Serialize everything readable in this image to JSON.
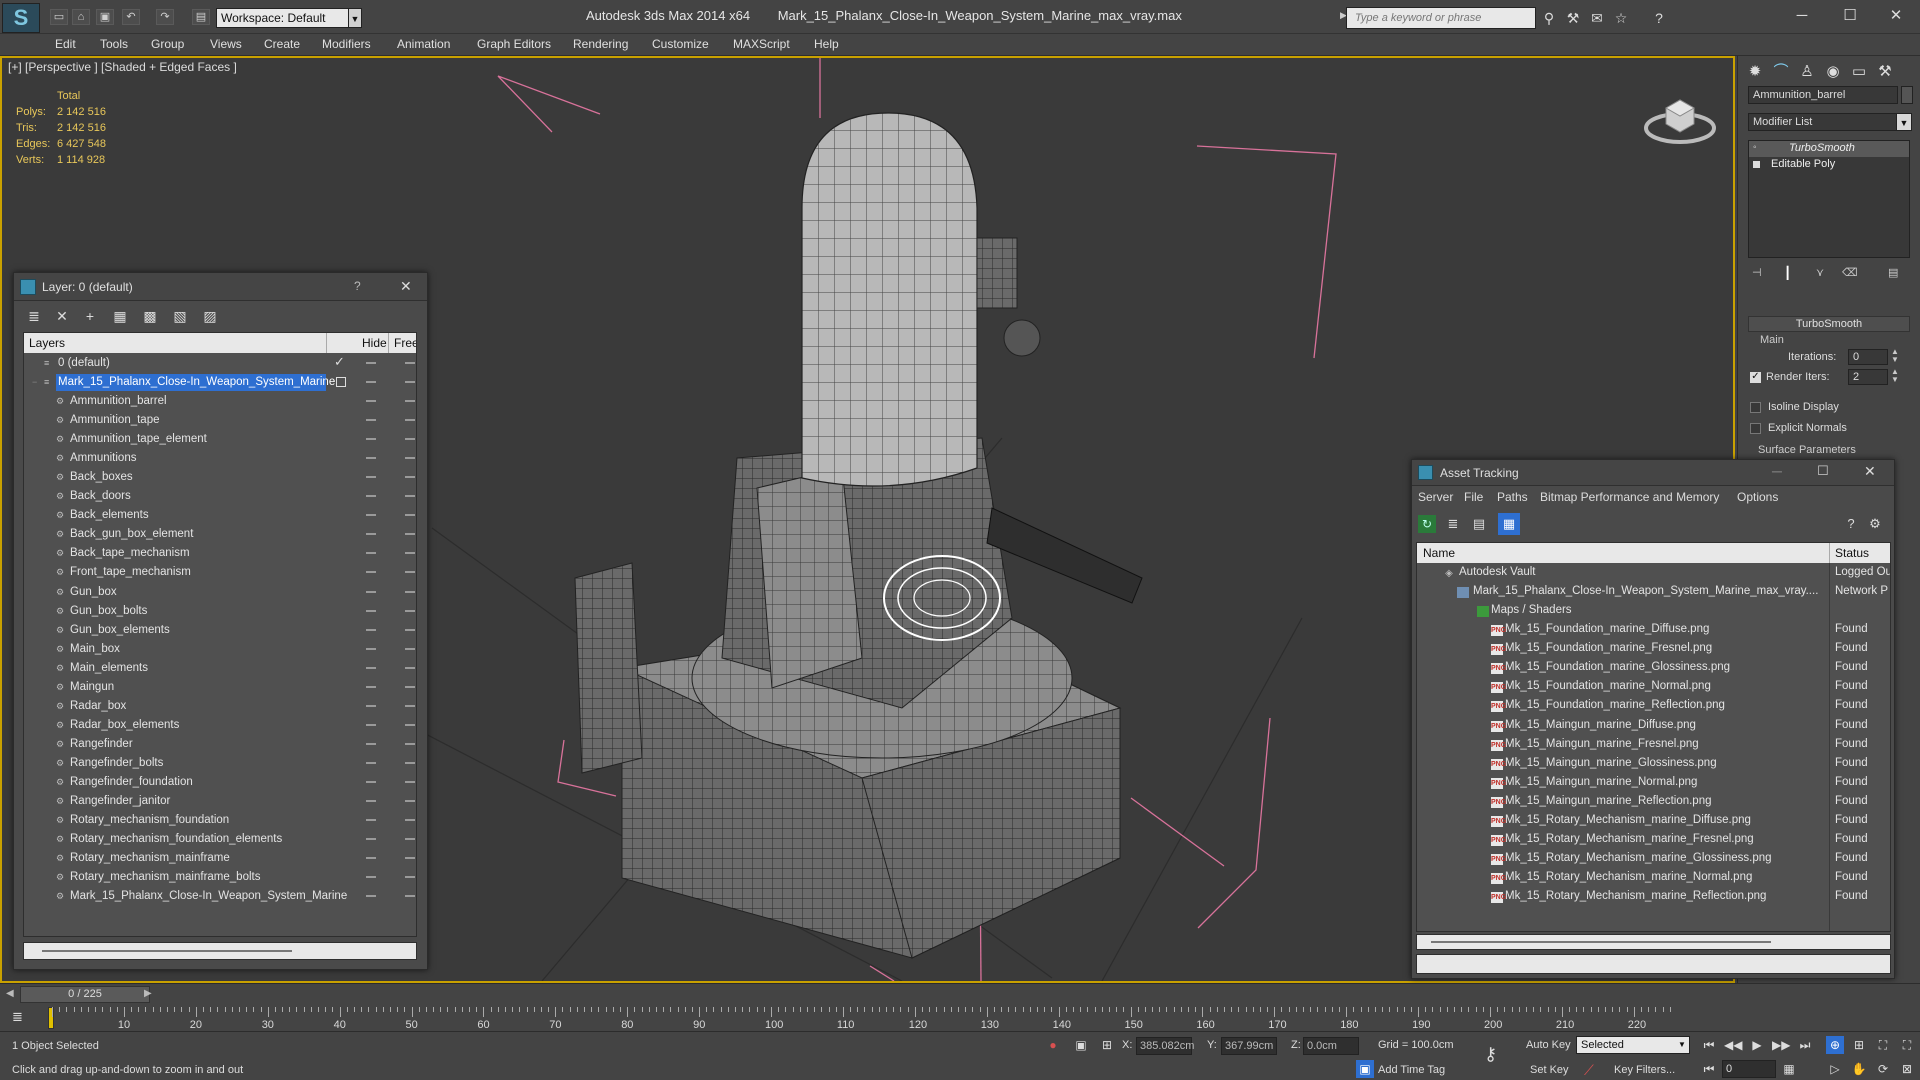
{
  "window": {
    "app_title": "Autodesk 3ds Max  2014 x64",
    "file_title": "Mark_15_Phalanx_Close-In_Weapon_System_Marine_max_vray.max",
    "workspace": "Workspace: Default",
    "search_placeholder": "Type a keyword or phrase"
  },
  "menu": [
    "Edit",
    "Tools",
    "Group",
    "Views",
    "Create",
    "Modifiers",
    "Animation",
    "Graph Editors",
    "Rendering",
    "Customize",
    "MAXScript",
    "Help"
  ],
  "viewport": {
    "label": "[+] [Perspective ] [Shaded + Edged Faces ]",
    "stats": {
      "header": "Total",
      "rows": [
        {
          "label": "Polys:",
          "value": "2 142 516"
        },
        {
          "label": "Tris:",
          "value": "2 142 516"
        },
        {
          "label": "Edges:",
          "value": "6 427 548"
        },
        {
          "label": "Verts:",
          "value": "1 114 928"
        }
      ]
    }
  },
  "layer_panel": {
    "title": "Layer: 0 (default)",
    "help": "?",
    "close": "✕",
    "columns": {
      "name": "Layers",
      "hide": "Hide",
      "freeze": "Free"
    },
    "default_layer": "0 (default)",
    "selected_layer": "Mark_15_Phalanx_Close-In_Weapon_System_Marine",
    "objects": [
      "Ammunition_barrel",
      "Ammunition_tape",
      "Ammunition_tape_element",
      "Ammunitions",
      "Back_boxes",
      "Back_doors",
      "Back_elements",
      "Back_gun_box_element",
      "Back_tape_mechanism",
      "Front_tape_mechanism",
      "Gun_box",
      "Gun_box_bolts",
      "Gun_box_elements",
      "Main_box",
      "Main_elements",
      "Maingun",
      "Radar_box",
      "Radar_box_elements",
      "Rangefinder",
      "Rangefinder_bolts",
      "Rangefinder_foundation",
      "Rangefinder_janitor",
      "Rotary_mechanism_foundation",
      "Rotary_mechanism_foundation_elements",
      "Rotary_mechanism_mainframe",
      "Rotary_mechanism_mainframe_bolts",
      "Mark_15_Phalanx_Close-In_Weapon_System_Marine"
    ]
  },
  "command_panel": {
    "object_name": "Ammunition_barrel",
    "modifier_list": "Modifier List",
    "stack": [
      "TurboSmooth",
      "Editable Poly"
    ],
    "rollout_title": "TurboSmooth",
    "main_label": "Main",
    "iterations_label": "Iterations:",
    "iterations_value": "0",
    "render_iters_label": "Render Iters:",
    "render_iters_value": "2",
    "render_iters_checked": true,
    "isoline_label": "Isoline Display",
    "explicit_normals_label": "Explicit Normals",
    "surface_params": "Surface Parameters"
  },
  "asset_tracking": {
    "title": "Asset Tracking",
    "menu": [
      "Server",
      "File",
      "Paths",
      "Bitmap Performance and Memory",
      "Options"
    ],
    "columns": {
      "name": "Name",
      "status": "Status"
    },
    "vault": {
      "name": "Autodesk Vault",
      "status": "Logged Ou"
    },
    "file": {
      "name": "Mark_15_Phalanx_Close-In_Weapon_System_Marine_max_vray....",
      "status": "Network P"
    },
    "group": "Maps / Shaders",
    "maps": [
      {
        "name": "Mk_15_Foundation_marine_Diffuse.png",
        "status": "Found"
      },
      {
        "name": "Mk_15_Foundation_marine_Fresnel.png",
        "status": "Found"
      },
      {
        "name": "Mk_15_Foundation_marine_Glossiness.png",
        "status": "Found"
      },
      {
        "name": "Mk_15_Foundation_marine_Normal.png",
        "status": "Found"
      },
      {
        "name": "Mk_15_Foundation_marine_Reflection.png",
        "status": "Found"
      },
      {
        "name": "Mk_15_Maingun_marine_Diffuse.png",
        "status": "Found"
      },
      {
        "name": "Mk_15_Maingun_marine_Fresnel.png",
        "status": "Found"
      },
      {
        "name": "Mk_15_Maingun_marine_Glossiness.png",
        "status": "Found"
      },
      {
        "name": "Mk_15_Maingun_marine_Normal.png",
        "status": "Found"
      },
      {
        "name": "Mk_15_Maingun_marine_Reflection.png",
        "status": "Found"
      },
      {
        "name": "Mk_15_Rotary_Mechanism_marine_Diffuse.png",
        "status": "Found"
      },
      {
        "name": "Mk_15_Rotary_Mechanism_marine_Fresnel.png",
        "status": "Found"
      },
      {
        "name": "Mk_15_Rotary_Mechanism_marine_Glossiness.png",
        "status": "Found"
      },
      {
        "name": "Mk_15_Rotary_Mechanism_marine_Normal.png",
        "status": "Found"
      },
      {
        "name": "Mk_15_Rotary_Mechanism_marine_Reflection.png",
        "status": "Found"
      }
    ]
  },
  "timeline": {
    "frame_counter": "0 / 225",
    "ticks": [
      "10",
      "20",
      "30",
      "40",
      "50",
      "60",
      "70",
      "80",
      "90",
      "100",
      "110",
      "120",
      "130",
      "140",
      "150",
      "160",
      "170",
      "180",
      "190",
      "200",
      "210",
      "220"
    ]
  },
  "status_bar": {
    "selection": "1 Object Selected",
    "prompt": "Click and drag up-and-down to zoom in and out",
    "x_label": "X:",
    "x_value": "385.082cm",
    "y_label": "Y:",
    "y_value": "367.99cm",
    "z_label": "Z:",
    "z_value": "0.0cm",
    "grid": "Grid = 100.0cm",
    "auto_key": "Auto Key",
    "set_key": "Set Key",
    "selected_option": "Selected",
    "key_filters": "Key Filters...",
    "add_time_tag": "Add Time Tag",
    "current_frame": "0"
  }
}
